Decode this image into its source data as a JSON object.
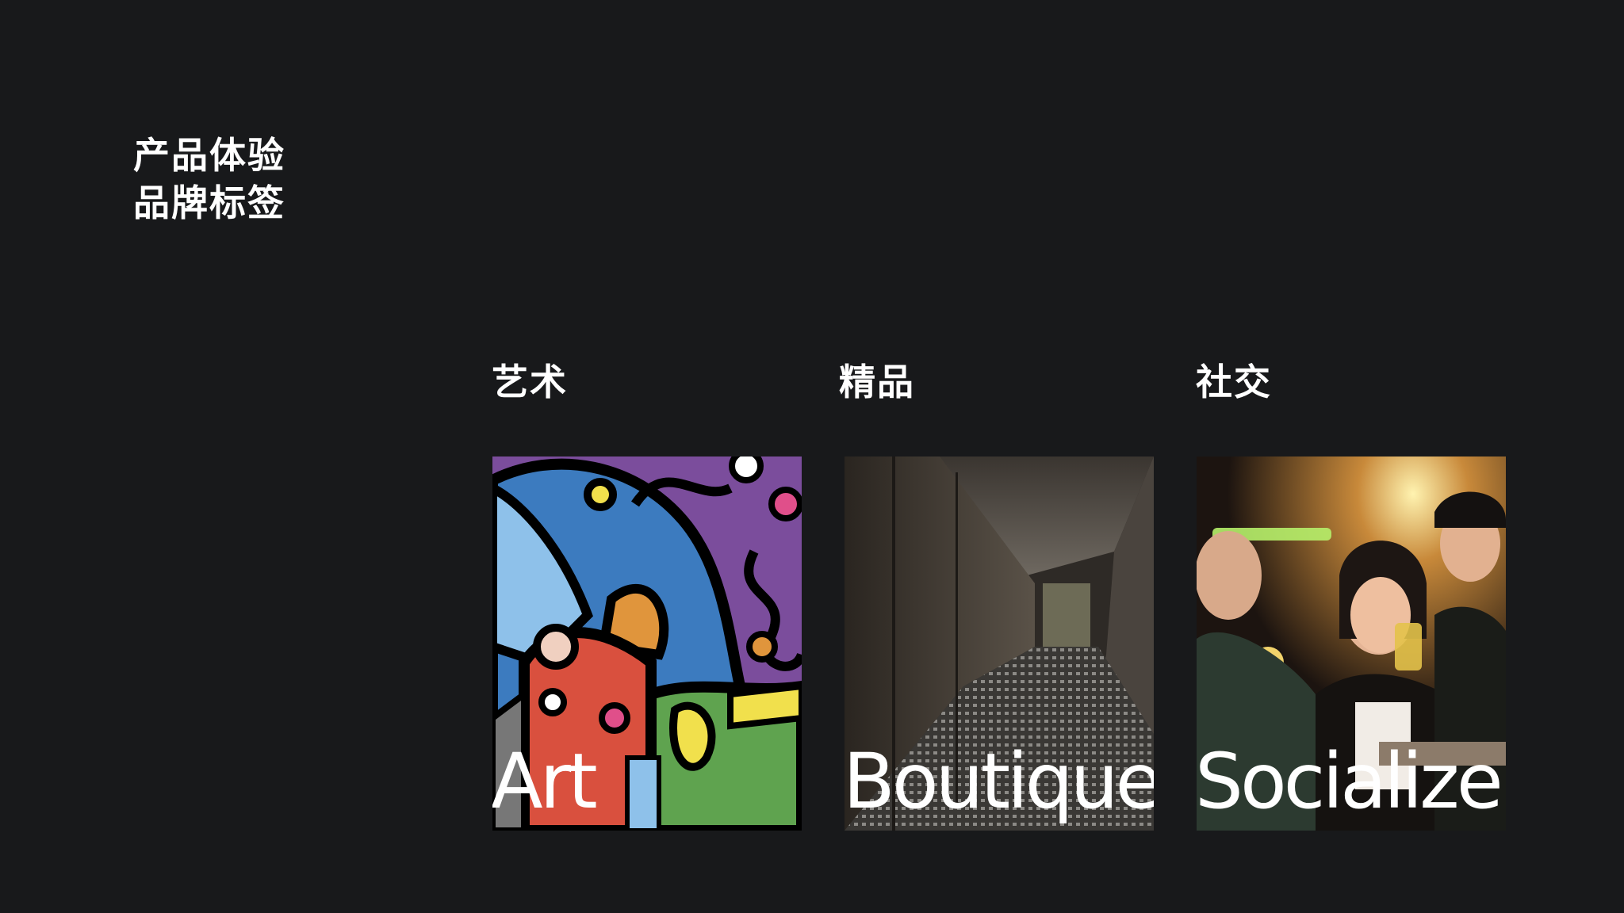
{
  "heading": {
    "line1": "产品体验",
    "line2": "品牌标签"
  },
  "categories": [
    {
      "label": "艺术",
      "caption": "Art"
    },
    {
      "label": "精品",
      "caption": "Boutique"
    },
    {
      "label": "社交",
      "caption": "Socialize"
    }
  ],
  "colors": {
    "background": "#18191b",
    "text": "#ffffff"
  }
}
